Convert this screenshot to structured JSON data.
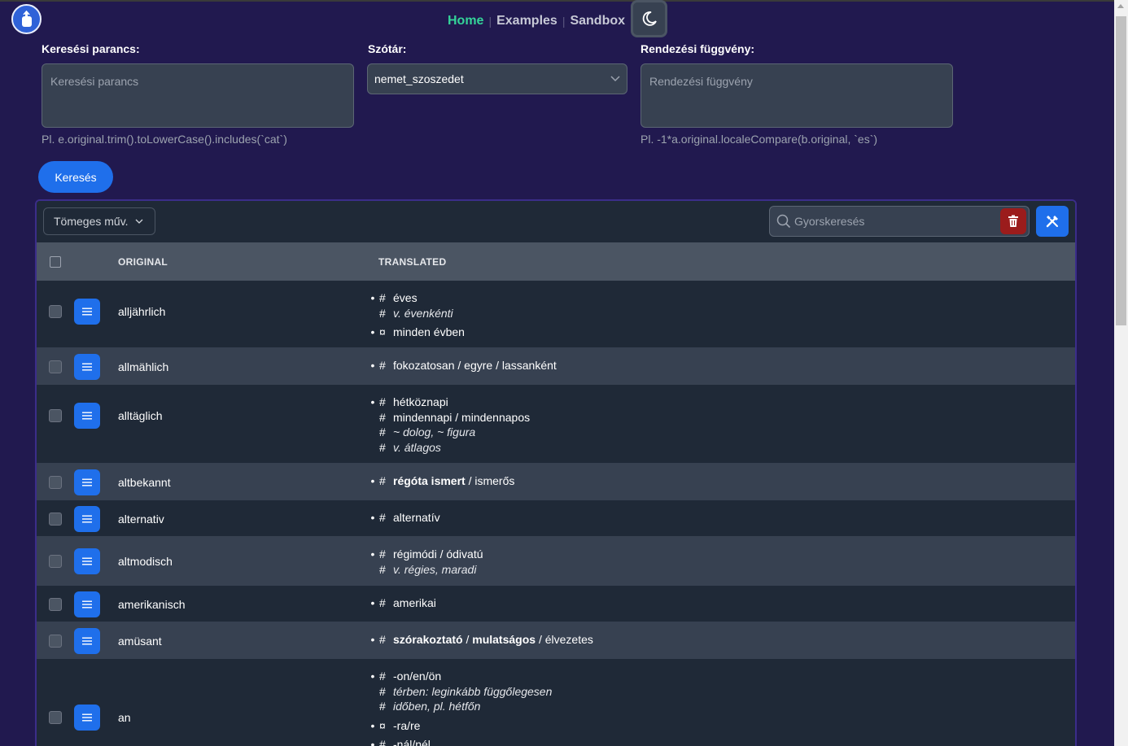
{
  "nav": {
    "home": "Home",
    "examples": "Examples",
    "sandbox": "Sandbox",
    "separator": "|"
  },
  "icons": {
    "logo": "upload-hand-icon",
    "theme": "moon-icon",
    "search": "search-icon",
    "clear": "trash-icon",
    "tools": "tools-icon",
    "menu": "list-icon",
    "chevron": "chevron-down-icon"
  },
  "colors": {
    "background": "#21194f",
    "accent": "#1f6feb",
    "active_nav": "#34d399",
    "danger": "#9b1c1c"
  },
  "search_command": {
    "label": "Keresési parancs:",
    "placeholder": "Keresési parancs",
    "hint": "Pl.  e.original.trim().toLowerCase().includes(`cat`)"
  },
  "dictionary": {
    "label": "Szótár:",
    "value": "nemet_szoszedet"
  },
  "sort_function": {
    "label": "Rendezési függvény:",
    "placeholder": "Rendezési függvény",
    "hint": "Pl.  -1*a.original.localeCompare(b.original, `es`)"
  },
  "search_button": "Keresés",
  "toolbar": {
    "bulk_actions": "Tömeges műv.",
    "quick_search_placeholder": "Gyorskeresés"
  },
  "table": {
    "columns": {
      "original": "ORIGINAL",
      "translated": "TRANSLATED"
    },
    "rows": [
      {
        "original": "alljährlich",
        "translated": [
          {
            "bullet": "•",
            "mark": "#",
            "parts": [
              {
                "t": "éves"
              }
            ]
          },
          {
            "bullet": "",
            "mark": "#",
            "parts": [
              {
                "t": "v. évenkénti",
                "s": "i"
              }
            ]
          },
          {
            "bullet": "•",
            "mark": "¤",
            "parts": [
              {
                "t": "minden évben"
              }
            ]
          }
        ]
      },
      {
        "original": "allmählich",
        "translated": [
          {
            "bullet": "•",
            "mark": "#",
            "parts": [
              {
                "t": "fokozatosan / egyre / lassanként"
              }
            ]
          }
        ]
      },
      {
        "original": "alltäglich",
        "translated": [
          {
            "bullet": "•",
            "mark": "#",
            "parts": [
              {
                "t": "hétköznapi"
              }
            ]
          },
          {
            "bullet": "",
            "mark": "#",
            "parts": [
              {
                "t": "mindennapi / mindennapos"
              }
            ]
          },
          {
            "bullet": "",
            "mark": "#",
            "parts": [
              {
                "t": "~ dolog, ~ figura",
                "s": "i"
              }
            ]
          },
          {
            "bullet": "",
            "mark": "#",
            "parts": [
              {
                "t": "v. átlagos",
                "s": "i"
              }
            ]
          }
        ]
      },
      {
        "original": "altbekannt",
        "translated": [
          {
            "bullet": "•",
            "mark": "#",
            "parts": [
              {
                "t": "régóta ismert",
                "s": "b"
              },
              {
                "t": " / ismerős"
              }
            ]
          }
        ]
      },
      {
        "original": "alternativ",
        "translated": [
          {
            "bullet": "•",
            "mark": "#",
            "parts": [
              {
                "t": "alternatív"
              }
            ]
          }
        ]
      },
      {
        "original": "altmodisch",
        "translated": [
          {
            "bullet": "•",
            "mark": "#",
            "parts": [
              {
                "t": "régimódi / ódivatú"
              }
            ]
          },
          {
            "bullet": "",
            "mark": "#",
            "parts": [
              {
                "t": "v. régies, maradi",
                "s": "i"
              }
            ]
          }
        ]
      },
      {
        "original": "amerikanisch",
        "translated": [
          {
            "bullet": "•",
            "mark": "#",
            "parts": [
              {
                "t": "amerikai"
              }
            ]
          }
        ]
      },
      {
        "original": "amüsant",
        "translated": [
          {
            "bullet": "•",
            "mark": "#",
            "parts": [
              {
                "t": "szórakoztató",
                "s": "b"
              },
              {
                "t": " / "
              },
              {
                "t": "mulatságos",
                "s": "b"
              },
              {
                "t": " / élvezetes"
              }
            ]
          }
        ]
      },
      {
        "original": "an",
        "translated": [
          {
            "bullet": "•",
            "mark": "#",
            "parts": [
              {
                "t": "-on/en/ön"
              }
            ]
          },
          {
            "bullet": "",
            "mark": "#",
            "parts": [
              {
                "t": "térben: leginkább függőlegesen",
                "s": "i"
              }
            ]
          },
          {
            "bullet": "",
            "mark": "#",
            "parts": [
              {
                "t": "időben, pl. hétfőn",
                "s": "i"
              }
            ]
          },
          {
            "bullet": "•",
            "mark": "¤",
            "parts": [
              {
                "t": "-ra/re"
              }
            ]
          },
          {
            "bullet": "•",
            "mark": "#",
            "parts": [
              {
                "t": "-nál/nél"
              }
            ]
          }
        ]
      }
    ]
  }
}
